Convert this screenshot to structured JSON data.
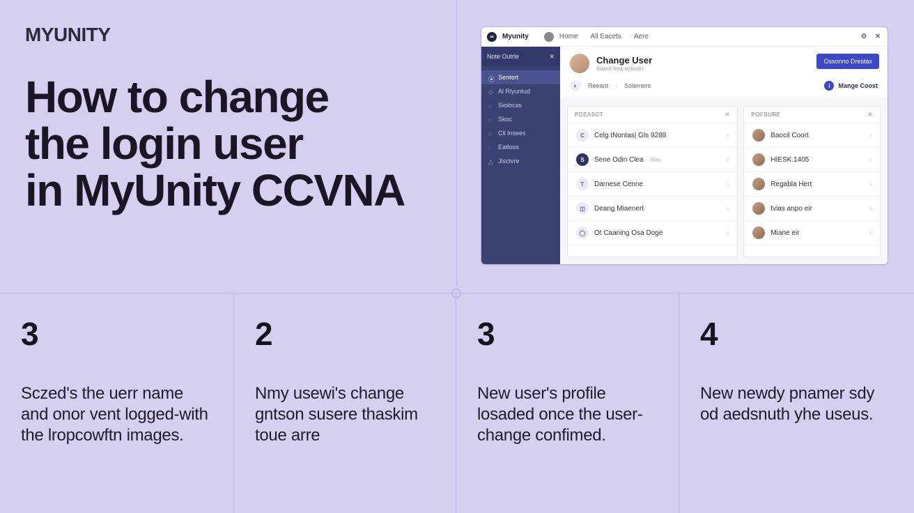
{
  "logo": "MYUNITY",
  "headline_l1": "How to change",
  "headline_l2": "the login user",
  "headline_l3": "in MyUnity CCVNA",
  "app": {
    "title": "Myunity",
    "crumbs": [
      "Home",
      "All Eacets",
      "Aere"
    ],
    "sidebar": {
      "header": "Note Outrle",
      "items": [
        {
          "label": "Sentert",
          "active": true
        },
        {
          "label": "Al Rlyuntud"
        },
        {
          "label": "Siolocas"
        },
        {
          "label": "Skoc"
        },
        {
          "label": "Cll Insees"
        },
        {
          "label": "Eatloos"
        },
        {
          "label": "Jlsctvre"
        }
      ]
    },
    "header": {
      "title": "Change User",
      "subtitle": "Insent less ontoutrr",
      "button": "Ossonno Drestax"
    },
    "tabs": {
      "a": "Reeant",
      "b": "Solemers",
      "right": "Mange Coost"
    },
    "leftPanel": {
      "title": "Pdeasct",
      "rows": [
        {
          "label": "Celg tNontas| Gls 9288"
        },
        {
          "label": "Sene Odin Clea",
          "sub": "blan",
          "dark": true
        },
        {
          "label": "Darnese Cenne"
        },
        {
          "label": "Deang Miaenert"
        },
        {
          "label": "Ot Caaning Osa Doge"
        }
      ]
    },
    "rightPanel": {
      "title": "Pofsure",
      "rows": [
        {
          "label": "Baocil Coort"
        },
        {
          "label": "HIESK.1405"
        },
        {
          "label": "Regabla Hert"
        },
        {
          "label": "tvias anpo eir"
        },
        {
          "label": "Miane eir"
        }
      ]
    }
  },
  "steps": [
    {
      "num": "3",
      "text": "Sczed's the uerr name and onor vent logged-with the lropcowftn images."
    },
    {
      "num": "2",
      "text": "Nmy usewi's change gntson susere thaskim toue arre"
    },
    {
      "num": "3",
      "text": "New user's profile losaded once the user-change confimed."
    },
    {
      "num": "4",
      "text": "New newdy pnamer sdy od aedsnuth yhe useus."
    }
  ]
}
